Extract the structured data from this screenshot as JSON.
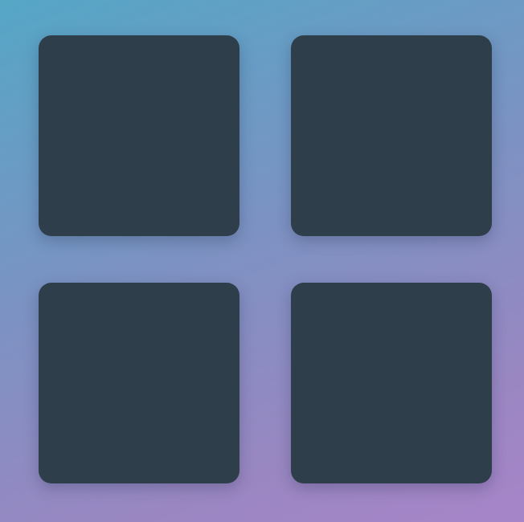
{
  "theme": {
    "background_gradient": [
      "#55a6c6",
      "#7c92c2",
      "#9a87c2",
      "#a784c8"
    ],
    "tile_color": "#2f3e4b"
  },
  "tiles": [
    {
      "id": "tile-1"
    },
    {
      "id": "tile-2"
    },
    {
      "id": "tile-3"
    },
    {
      "id": "tile-4"
    }
  ]
}
